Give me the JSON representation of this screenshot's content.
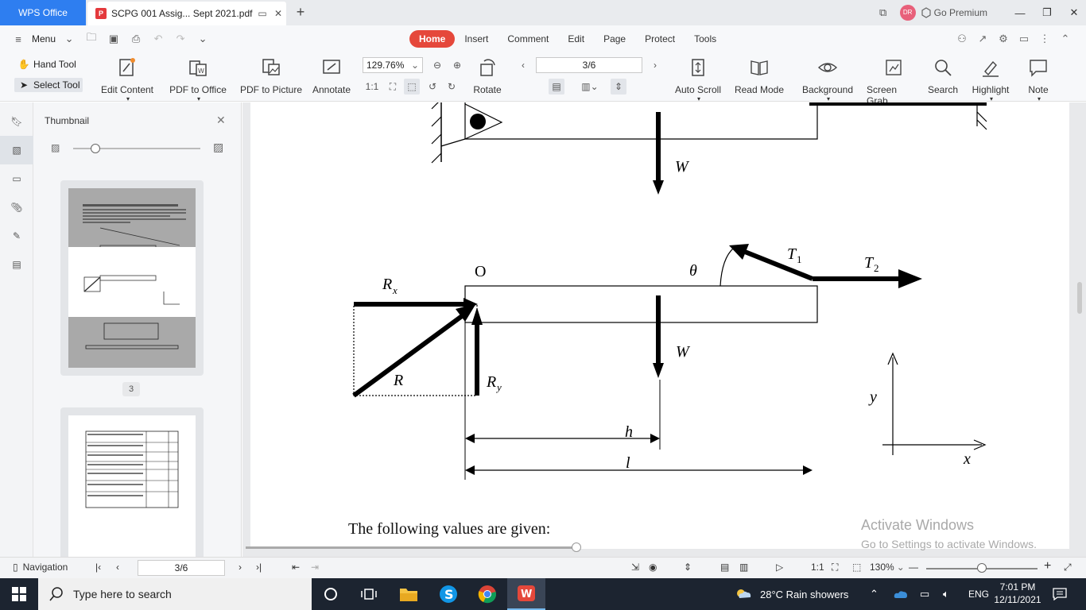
{
  "titlebar": {
    "app_tab": "WPS Office",
    "doc_tab": "SCPG 001 Assig... Sept 2021.pdf",
    "go_premium": "Go Premium",
    "avatar": "DR"
  },
  "menubar": {
    "menu_label": "Menu",
    "tabs": [
      "Home",
      "Insert",
      "Comment",
      "Edit",
      "Page",
      "Protect",
      "Tools"
    ],
    "active_tab": "Home"
  },
  "ribbon": {
    "hand_tool": "Hand Tool",
    "select_tool": "Select Tool",
    "edit_content": "Edit Content",
    "pdf_to_office": "PDF to Office",
    "pdf_to_picture": "PDF to Picture",
    "annotate": "Annotate",
    "zoom": "129.76%",
    "rotate": "Rotate",
    "page_indicator": "3/6",
    "auto_scroll": "Auto Scroll",
    "read_mode": "Read Mode",
    "background": "Background",
    "screen_grab": "Screen Grab",
    "search": "Search",
    "highlight": "Highlight",
    "note": "Note"
  },
  "thumbnail": {
    "title": "Thumbnail",
    "page_number": "3"
  },
  "document": {
    "labels": {
      "W_top": "W",
      "O": "O",
      "theta": "θ",
      "T1": "T",
      "T1_sub": "1",
      "T2": "T",
      "T2_sub": "2",
      "Rx": "R",
      "Rx_sub": "x",
      "W_mid": "W",
      "R": "R",
      "Ry": "R",
      "Ry_sub": "y",
      "h": "h",
      "l": "l",
      "y": "y",
      "x": "x"
    },
    "body_text": "The following values are given:",
    "watermark_title": "Activate Windows",
    "watermark_sub": "Go to Settings to activate Windows."
  },
  "statusbar": {
    "navigation": "Navigation",
    "page": "3/6",
    "zoom": "130%"
  },
  "taskbar": {
    "search_placeholder": "Type here to search",
    "weather": "28°C  Rain showers",
    "language": "ENG",
    "time": "7:01 PM",
    "date": "12/11/2021"
  }
}
